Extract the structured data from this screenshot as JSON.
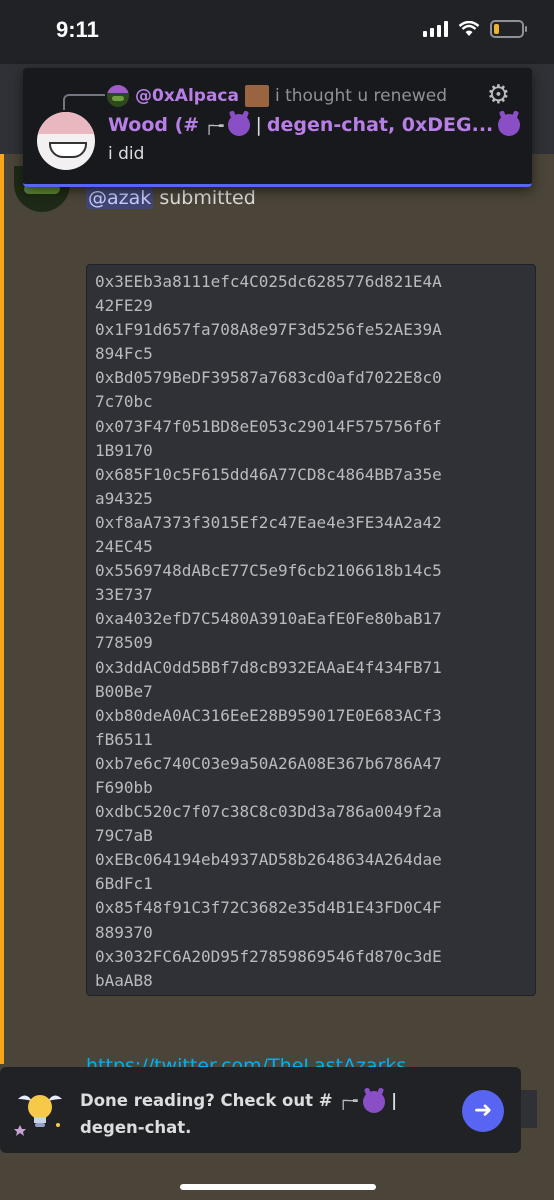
{
  "status_bar": {
    "time": "9:11"
  },
  "reply_popup": {
    "referenced_user": "@0xAlpaca",
    "referenced_text": "i thought u renewed",
    "author": "Wood (#",
    "channel_bracket": "┌╼",
    "channel_text": "degen-chat, 0xDEG...",
    "separator": "|",
    "reply_text": "i did"
  },
  "message": {
    "mention": "@azak",
    "text": "submitted",
    "addresses": [
      "0x3EEb3a8111efc4C025dc6285776d821E4A",
      "42FE29",
      "0x1F91d657fa708A8e97F3d5256fe52AE39A",
      "894Fc5",
      "0xBd0579BeDF39587a7683cd0afd7022E8c0",
      "7c70bc",
      "0x073F47f051BD8eE053c29014F575756f6f",
      "1B9170",
      "0x685F10c5F615dd46A77CD8c4864BB7a35e",
      "a94325",
      "0xf8aA7373f3015Ef2c47Eae4e3FE34A2a42",
      "24EC45",
      "0x5569748dABcE77C5e9f6cb2106618b14c5",
      "33E737",
      "0xa4032efD7C5480A3910aEafE0Fe80baB17",
      "778509",
      "0x3ddAC0dd5BBf7d8cB932EAAaE4f434FB71",
      "B00Be7",
      "0xb80deA0AC316EeE28B959017E0E683ACf3",
      "fB6511",
      "0xb7e6c740C03e9a50A26A08E367b6786A47",
      "F690bb",
      "0xdbC520c7f07c38C8c03Dd3a786a0049f2a",
      "79C7aB",
      "0xEBc064194eb4937AD58b2648634A264dae",
      "6BdFc1",
      "0x85f48f91C3f72C3682e35d4B1E43FD0C4F",
      "889370",
      "0x3032FC6A20D95f27859869546fd870c3dE",
      "bAaAB8"
    ],
    "link_partial": "https://twitter.com/TheLastAzarks"
  },
  "banner": {
    "text_before": "Done reading? Check out #",
    "bracket": "┌╼",
    "separator": "|",
    "text_after": "degen-chat."
  },
  "colors": {
    "accent": "#5865f2",
    "mention_bar": "#faa61a",
    "username": "#b87fe6"
  }
}
